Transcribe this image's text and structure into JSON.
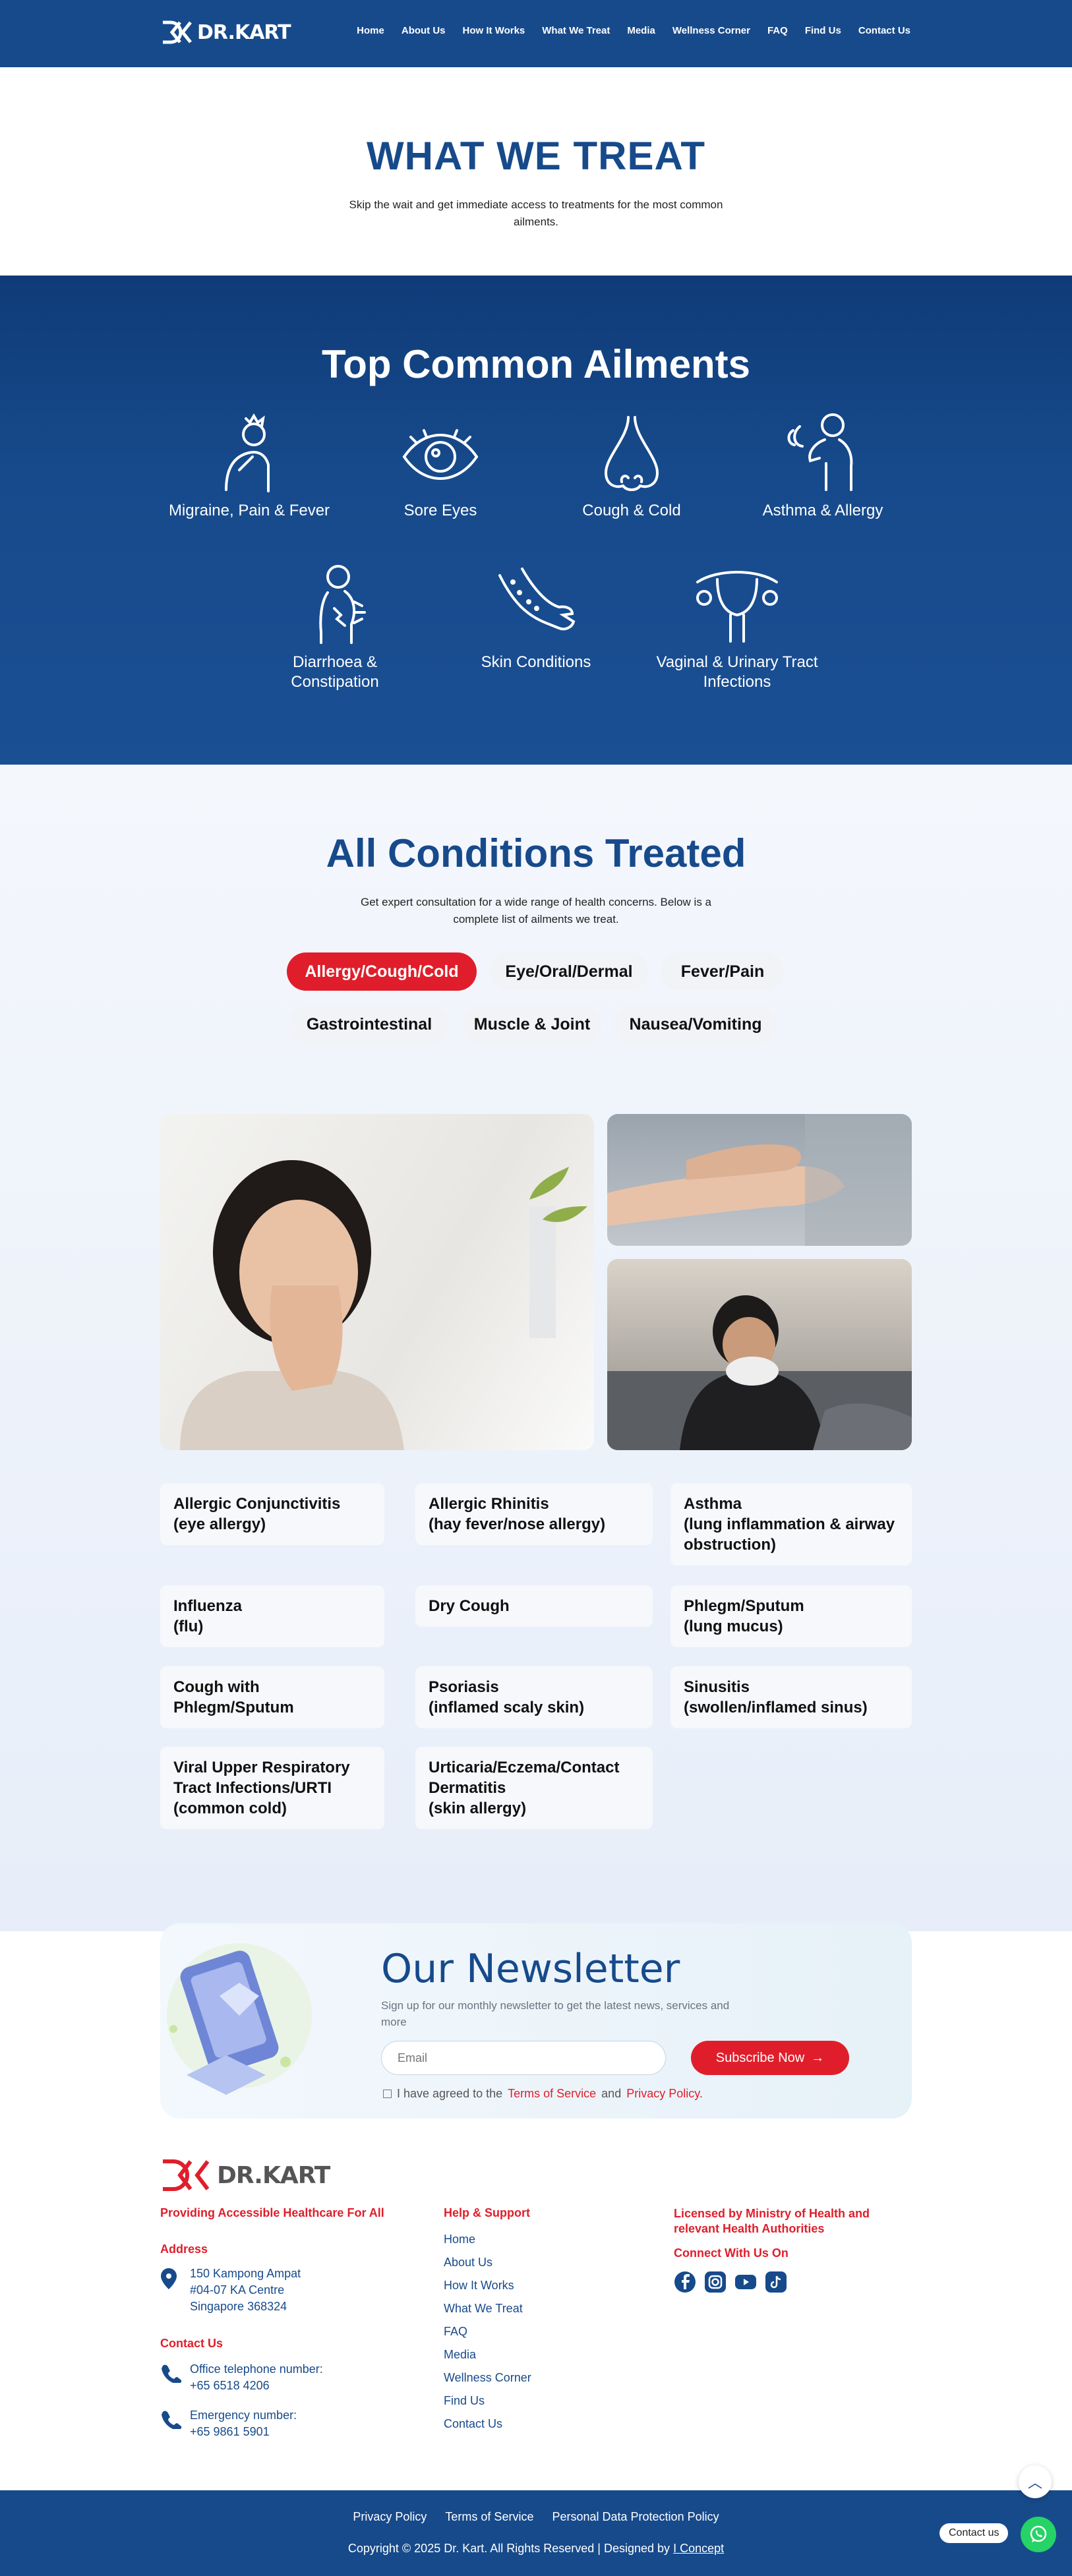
{
  "brand": {
    "name": "DR.KART",
    "colors": {
      "primary": "#174a8b",
      "accent": "#e01e2b"
    }
  },
  "nav": {
    "items": [
      "Home",
      "About Us",
      "How It Works",
      "What We Treat",
      "Media",
      "Wellness Corner",
      "FAQ",
      "Find Us",
      "Contact Us"
    ]
  },
  "hero": {
    "title": "WHAT WE TREAT",
    "subtitle": "Skip the wait and get immediate access to treatments for the most common ailments."
  },
  "ailments": {
    "title": "Top Common Ailments",
    "items": [
      {
        "label": "Migraine, Pain & Fever",
        "icon": "migraine-icon"
      },
      {
        "label": "Sore Eyes",
        "icon": "eye-icon"
      },
      {
        "label": "Cough & Cold",
        "icon": "nose-icon"
      },
      {
        "label": "Asthma & Allergy",
        "icon": "asthma-icon"
      },
      {
        "label": "Diarrhoea & Constipation",
        "icon": "stomach-icon"
      },
      {
        "label": "Skin Conditions",
        "icon": "skin-icon"
      },
      {
        "label": "Vaginal & Urinary Tract Infections",
        "icon": "uterus-icon"
      }
    ]
  },
  "conditions": {
    "title": "All Conditions Treated",
    "subtitle": "Get expert consultation for a wide range of health concerns. Below is a complete list of ailments we treat.",
    "tabs": [
      "Allergy/Cough/Cold",
      "Eye/Oral/Dermal",
      "Fever/Pain",
      "Gastrointestinal",
      "Muscle & Joint",
      "Nausea/Vomiting"
    ],
    "active_tab": "Allergy/Cough/Cold",
    "items": [
      {
        "name": "Allergic Conjunctivitis",
        "note": "(eye allergy)"
      },
      {
        "name": "Allergic Rhinitis",
        "note": "(hay fever/nose allergy)"
      },
      {
        "name": "Asthma",
        "note": "(lung inflammation & airway obstruction)"
      },
      {
        "name": "Influenza",
        "note": "(flu)"
      },
      {
        "name": "Dry Cough",
        "note": ""
      },
      {
        "name": "Phlegm/Sputum",
        "note": "(lung mucus)"
      },
      {
        "name": "Cough with Phlegm/Sputum",
        "note": ""
      },
      {
        "name": "Psoriasis",
        "note": "(inflamed scaly skin)"
      },
      {
        "name": "Sinusitis",
        "note": "(swollen/inflamed sinus)"
      },
      {
        "name": "Viral Upper Respiratory Tract Infections/URTI",
        "note": "(common cold)"
      },
      {
        "name": "Urticaria/Eczema/Contact Dermatitis",
        "note": "(skin allergy)"
      }
    ]
  },
  "newsletter": {
    "title": "Our Newsletter",
    "subtitle": "Sign up for our monthly newsletter to get the latest news, services and more",
    "email_placeholder": "Email",
    "button": "Subscribe Now",
    "agree_prefix": "I have agreed to the",
    "terms": "Terms of Service",
    "and": "and",
    "privacy": "Privacy Policy."
  },
  "footer": {
    "tagline": "Providing Accessible Healthcare For All",
    "address_heading": "Address",
    "address": [
      "150 Kampong Ampat",
      "#04-07 KA Centre",
      "Singapore 368324"
    ],
    "contact_heading": "Contact Us",
    "office_label": "Office telephone number:",
    "office_phone": "+65 6518 4206",
    "emergency_label": "Emergency number:",
    "emergency_phone": "+65 9861 5901",
    "help_heading": "Help & Support",
    "links": [
      "Home",
      "About Us",
      "How It Works",
      "What We Treat",
      "FAQ",
      "Media",
      "Wellness Corner",
      "Find Us",
      "Contact Us"
    ],
    "licensed": "Licensed by Ministry of Health and relevant Health Authorities",
    "connect": "Connect With Us On",
    "social": [
      "facebook-icon",
      "instagram-icon",
      "youtube-icon",
      "tiktok-icon"
    ],
    "bottom_links": [
      "Privacy Policy",
      "Terms of Service",
      "Personal Data Protection Policy"
    ],
    "copyright": "Copyright © 2025 Dr. Kart. All Rights Reserved | Designed by",
    "designer": "I Concept",
    "contact_us": "Contact us"
  }
}
